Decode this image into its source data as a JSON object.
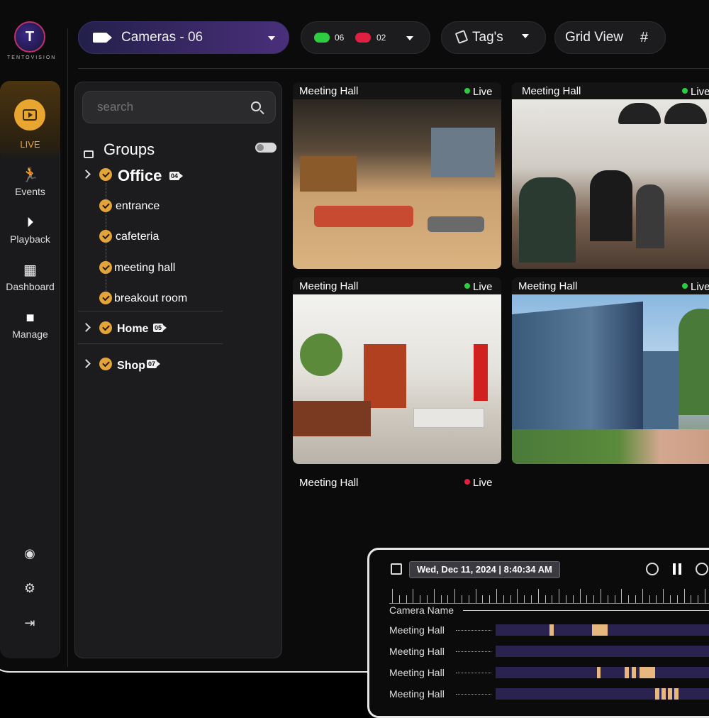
{
  "brand": {
    "name": "TENTOVISION"
  },
  "nav": {
    "live": "LIVE",
    "items": [
      {
        "label": "Events",
        "icon": "running-person-icon"
      },
      {
        "label": "Playback",
        "icon": "playback-icon"
      },
      {
        "label": "Dashboard",
        "icon": "dashboard-grid-icon"
      },
      {
        "label": "Manage",
        "icon": "camera-manage-icon"
      }
    ],
    "bottom_icons": [
      "user-icon",
      "settings-sync-icon",
      "logout-icon"
    ]
  },
  "toolbar": {
    "cameras_label": "Cameras - 06",
    "online_count": "06",
    "offline_count": "02",
    "tags_label": "Tag's",
    "view_label": "Grid View"
  },
  "sidebar": {
    "search_placeholder": "search",
    "groups_title": "Groups",
    "groups": [
      {
        "name": "Office",
        "count": "04",
        "children": [
          "entrance",
          "cafeteria",
          "meeting hall",
          "breakout room"
        ]
      },
      {
        "name": "Home",
        "count": "05"
      },
      {
        "name": "Shop",
        "count": "07"
      }
    ]
  },
  "cameras": [
    {
      "name": "Meeting Hall",
      "status": "Live",
      "status_color": "#2ecc40"
    },
    {
      "name": "Meeting Hall",
      "status": "Live",
      "status_color": "#2ecc40"
    },
    {
      "name": "Meeting Hall",
      "status": "Live",
      "status_color": "#2ecc40"
    },
    {
      "name": "Meeting Hall",
      "status": "Live",
      "status_color": "#2ecc40"
    },
    {
      "name": "Meeting Hall",
      "status": "Live",
      "status_color": "#e02040"
    }
  ],
  "timeline": {
    "datetime": "Wed, Dec 11, 2024 | 8:40:34 AM",
    "camera_name_header": "Camera Name",
    "rows": [
      "Meeting Hall",
      "Meeting Hall",
      "Meeting Hall",
      "Meeting Hall"
    ]
  },
  "colors": {
    "accent": "#e3a53a",
    "online": "#2ecc40",
    "offline": "#e02040",
    "camera_pill": "#4a2f7a"
  }
}
